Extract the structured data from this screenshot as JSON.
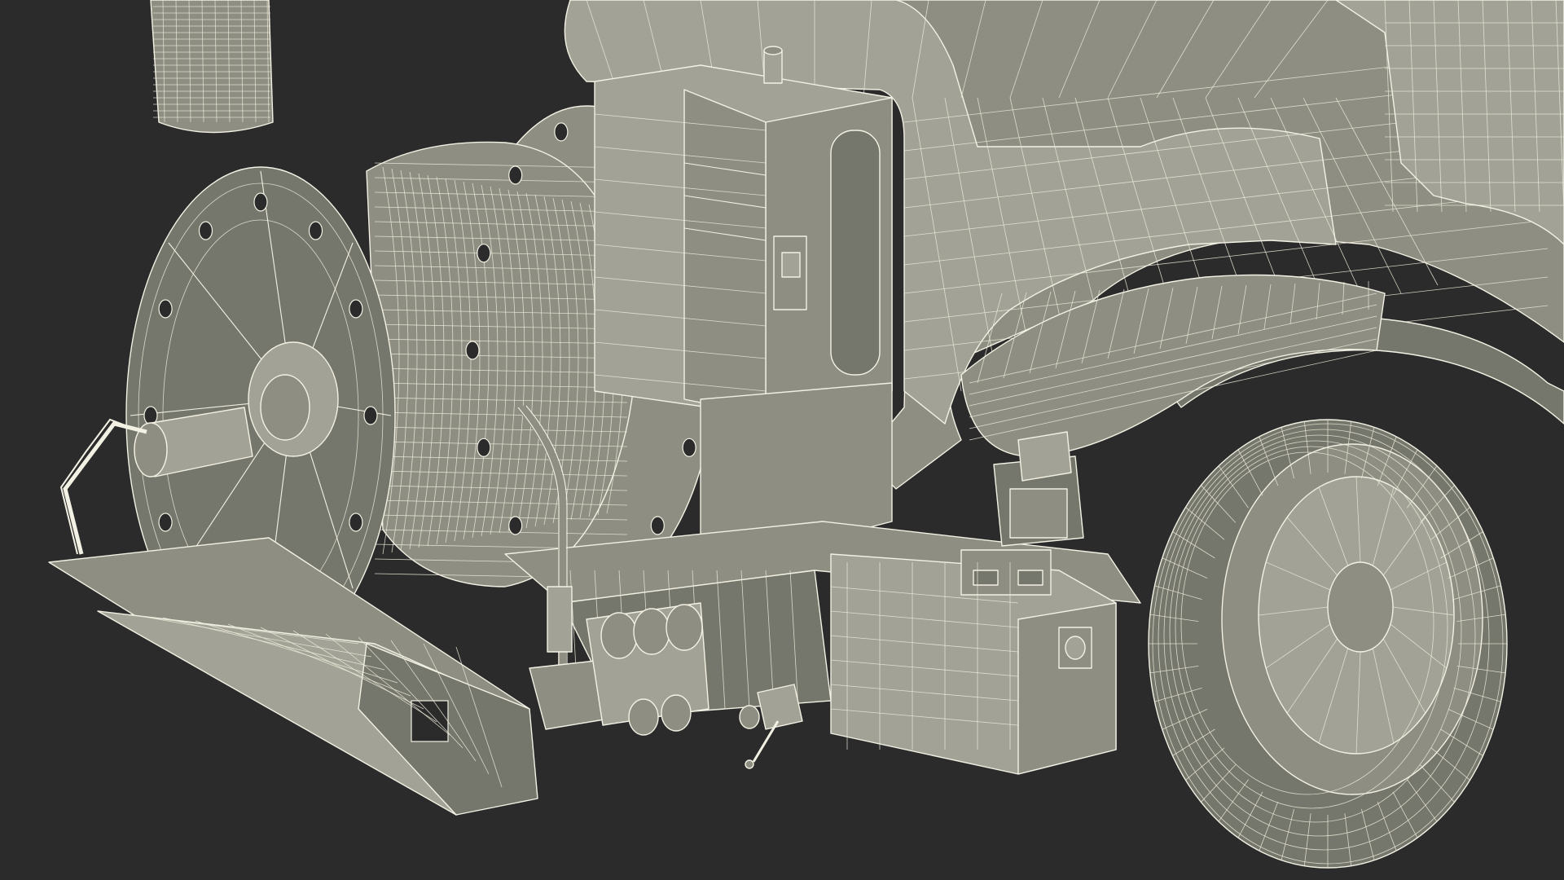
{
  "scene": {
    "background": "#2b2b2b",
    "mesh_fill": "#8e8f82",
    "wire_color": "#f3f1e4",
    "render_style": "wireframe-over-clay"
  }
}
